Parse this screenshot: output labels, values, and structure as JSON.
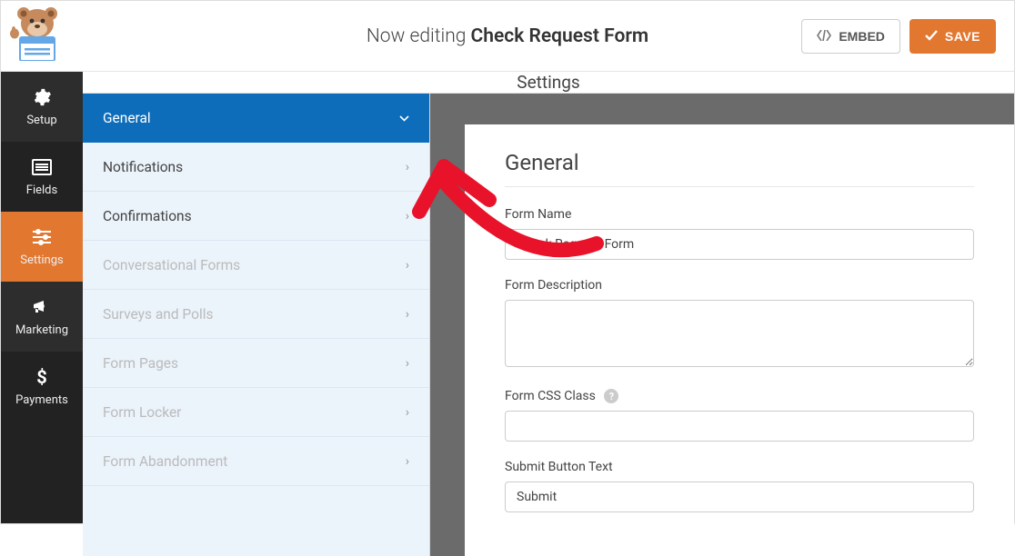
{
  "header": {
    "editing_prefix": "Now editing ",
    "form_title": "Check Request Form",
    "embed_label": "EMBED",
    "save_label": "SAVE"
  },
  "nav": {
    "setup": "Setup",
    "fields": "Fields",
    "settings": "Settings",
    "marketing": "Marketing",
    "payments": "Payments"
  },
  "panel_title": "Settings",
  "sidebar": {
    "items": [
      {
        "label": "General",
        "state": "active"
      },
      {
        "label": "Notifications",
        "state": "normal"
      },
      {
        "label": "Confirmations",
        "state": "normal"
      },
      {
        "label": "Conversational Forms",
        "state": "disabled"
      },
      {
        "label": "Surveys and Polls",
        "state": "disabled"
      },
      {
        "label": "Form Pages",
        "state": "disabled"
      },
      {
        "label": "Form Locker",
        "state": "disabled"
      },
      {
        "label": "Form Abandonment",
        "state": "disabled"
      }
    ]
  },
  "form": {
    "section_title": "General",
    "form_name_label": "Form Name",
    "form_name_value": "Check Request Form",
    "form_description_label": "Form Description",
    "form_description_value": "",
    "form_css_class_label": "Form CSS Class",
    "form_css_class_value": "",
    "submit_button_text_label": "Submit Button Text",
    "submit_button_text_value": "Submit"
  }
}
